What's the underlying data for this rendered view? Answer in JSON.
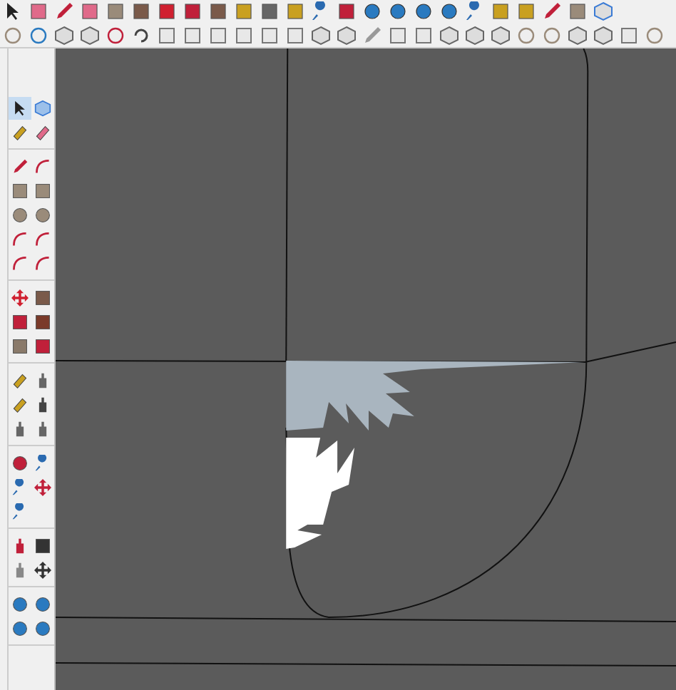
{
  "tool_palette": {
    "groups": [
      {
        "tools": [
          {
            "selected": true
          },
          {
            "selected": false
          },
          {
            "selected": false
          },
          {
            "selected": false
          }
        ]
      },
      {
        "tools": [
          {
            "selected": false
          },
          {
            "selected": false
          },
          {
            "selected": false
          },
          {
            "selected": false
          },
          {
            "selected": false
          },
          {
            "selected": false
          },
          {
            "selected": false
          },
          {
            "selected": false
          },
          {
            "selected": false
          },
          {
            "selected": false
          }
        ]
      },
      {
        "tools": [
          {
            "selected": false
          },
          {
            "selected": false
          },
          {
            "selected": false
          },
          {
            "selected": false
          },
          {
            "selected": false
          },
          {
            "selected": false
          }
        ]
      },
      {
        "tools": [
          {
            "selected": false
          },
          {
            "selected": false
          },
          {
            "selected": false
          },
          {
            "selected": false
          },
          {
            "selected": false
          },
          {
            "selected": false
          }
        ]
      },
      {
        "tools": [
          {
            "selected": false
          },
          {
            "selected": false
          },
          {
            "selected": false
          },
          {
            "selected": false
          },
          {
            "selected": false
          }
        ]
      },
      {
        "tools": [
          {
            "selected": false
          },
          {
            "selected": false
          },
          {
            "selected": false
          },
          {
            "selected": false
          }
        ]
      },
      {
        "tools": [
          {
            "selected": false
          },
          {
            "selected": false
          },
          {
            "selected": false
          },
          {
            "selected": false
          }
        ]
      }
    ]
  }
}
